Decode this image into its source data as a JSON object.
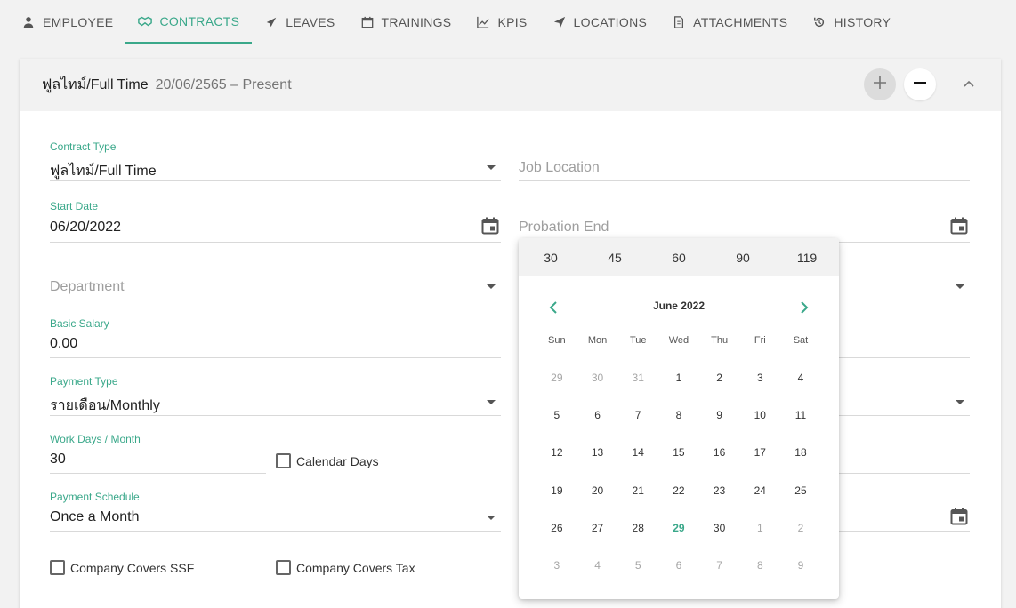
{
  "tabs": [
    {
      "label": "EMPLOYEE",
      "icon": "person-icon"
    },
    {
      "label": "CONTRACTS",
      "icon": "handshake-icon"
    },
    {
      "label": "LEAVES",
      "icon": "plane-icon"
    },
    {
      "label": "TRAININGS",
      "icon": "calendar-icon"
    },
    {
      "label": "KPIS",
      "icon": "chart-line-icon"
    },
    {
      "label": "LOCATIONS",
      "icon": "location-arrow-icon"
    },
    {
      "label": "ATTACHMENTS",
      "icon": "file-icon"
    },
    {
      "label": "HISTORY",
      "icon": "history-icon"
    }
  ],
  "active_tab": "CONTRACTS",
  "accent_color": "#3aa88a",
  "contract": {
    "title": "ฟูลไทม์/Full Time",
    "dates": "20/06/2565 – Present"
  },
  "form": {
    "contract_type": {
      "label": "Contract Type",
      "value": "ฟูลไทม์/Full Time"
    },
    "job_location": {
      "placeholder": "Job Location"
    },
    "start_date": {
      "label": "Start Date",
      "value": "06/20/2022"
    },
    "probation_end": {
      "placeholder": "Probation End"
    },
    "department": {
      "placeholder": "Department"
    },
    "basic_salary": {
      "label": "Basic Salary",
      "value": "0.00"
    },
    "payment_type": {
      "label": "Payment Type",
      "value": "รายเดือน/Monthly"
    },
    "work_days": {
      "label": "Work Days / Month",
      "value": "30"
    },
    "calendar_days": {
      "label": "Calendar Days"
    },
    "payment_schedule": {
      "label": "Payment Schedule",
      "value": "Once a Month"
    },
    "company_covers_ssf": {
      "label": "Company Covers SSF"
    },
    "company_covers_tax": {
      "label": "Company Covers Tax"
    }
  },
  "datepicker": {
    "presets": [
      "30",
      "45",
      "60",
      "90",
      "119"
    ],
    "month_label": "June 2022",
    "weekdays": [
      "Sun",
      "Mon",
      "Tue",
      "Wed",
      "Thu",
      "Fri",
      "Sat"
    ],
    "weeks": [
      [
        "29",
        "30",
        "31",
        "1",
        "2",
        "3",
        "4"
      ],
      [
        "5",
        "6",
        "7",
        "8",
        "9",
        "10",
        "11"
      ],
      [
        "12",
        "13",
        "14",
        "15",
        "16",
        "17",
        "18"
      ],
      [
        "19",
        "20",
        "21",
        "22",
        "23",
        "24",
        "25"
      ],
      [
        "26",
        "27",
        "28",
        "29",
        "30",
        "1",
        "2"
      ],
      [
        "3",
        "4",
        "5",
        "6",
        "7",
        "8",
        "9"
      ]
    ],
    "today": "29"
  }
}
